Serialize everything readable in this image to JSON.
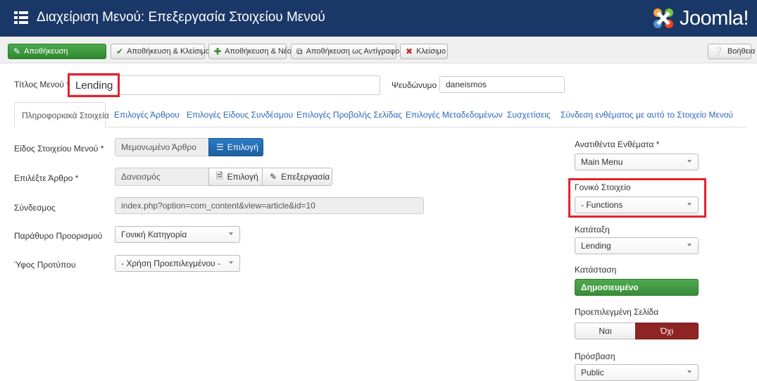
{
  "header": {
    "title": "Διαχείριση Μενού: Επεξεργασία Στοιχείου Μενού",
    "logo_text": "Joomla!"
  },
  "toolbar": {
    "save": "Αποθήκευση",
    "save_close": "Αποθήκευση & Κλείσιμο",
    "save_new": "Αποθήκευση & Νέο",
    "save_copy": "Αποθήκευση ως Αντίγραφο",
    "close": "Κλείσιμο",
    "help": "Βοήθεια"
  },
  "title_row": {
    "title_label": "Τίτλος Μενού *",
    "title_value": "Lending",
    "alias_label": "Ψευδώνυμο",
    "alias_value": "daneismos"
  },
  "tabs": [
    "Πληροφοριακά Στοιχεία",
    "Επιλογές Άρθρου",
    "Επιλογές Είδους Συνδέσμου",
    "Επιλογές Προβολής Σελίδας",
    "Επιλογές Μεταδεδομένων",
    "Συσχετίσεις",
    "Σύνδεση ενθέματος με αυτό το Στοιχείο Μενού"
  ],
  "form": {
    "type_label": "Είδος Στοιχείου Μενού *",
    "type_value": "Μεμονωμένο Άρθρο",
    "type_button": "Επιλογή",
    "article_label": "Επιλέξτε Άρθρο *",
    "article_value": "Δανεισμός",
    "article_select": "Επιλογή",
    "article_edit": "Επεξεργασία",
    "link_label": "Σύνδεσμος",
    "link_value": "index.php?option=com_content&view=article&id=10",
    "target_label": "Παράθυρο Προορισμού",
    "target_value": "Γονική Κατηγορία",
    "style_label": "Ύφος Προτύπου",
    "style_value": "- Χρήση Προεπιλεγμένου -"
  },
  "side": {
    "menu_label": "Ανατιθέντα Ενθέματα *",
    "menu_value": "Main Menu",
    "parent_label": "Γονικό Στοιχείο",
    "parent_value": "- Functions",
    "order_label": "Κατάταξη",
    "order_value": "Lending",
    "status_label": "Κατάσταση",
    "status_value": "Δημοσιευμένο",
    "default_label": "Προεπιλεγμένη Σελίδα",
    "yes": "Ναι",
    "no": "Όχι",
    "access_label": "Πρόσβαση",
    "access_value": "Public"
  },
  "colors": {
    "header": "#1a3867",
    "save_green": "#2f892f",
    "highlight_red": "#e3222f",
    "no_red": "#8f2424"
  }
}
